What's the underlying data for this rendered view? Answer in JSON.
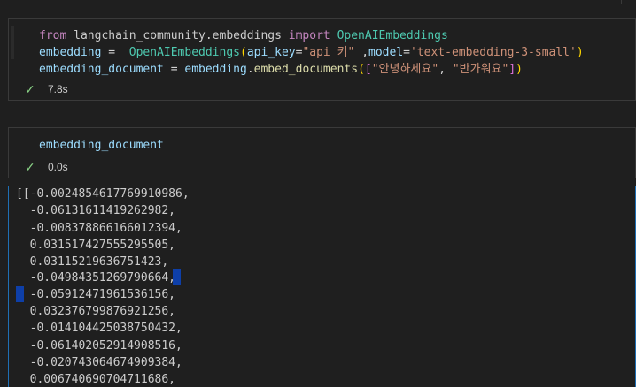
{
  "cells": [
    {
      "code": {
        "line1": {
          "kw_from": "from",
          "module": "langchain_community.embeddings",
          "kw_import": "import",
          "cls": "OpenAIEmbeddings"
        },
        "line2": {
          "var": "embedding",
          "eq": "=",
          "cls": "OpenAIEmbeddings",
          "paren_open": "(",
          "arg1_name": "api_key",
          "arg1_eq": "=",
          "arg1_val": "\"api 키\"",
          "comma": " ,",
          "arg2_name": "model",
          "arg2_eq": "=",
          "arg2_val": "'text-embedding-3-small'",
          "paren_close": ")"
        },
        "line3": {
          "var": "embedding_document",
          "eq": "=",
          "obj": "embedding",
          "dot": ".",
          "fn": "embed_documents",
          "paren_open": "(",
          "bracket_open": "[",
          "str1": "\"안녕하세요\"",
          "comma": ",",
          "str2": "\"반가워요\"",
          "bracket_close": "]",
          "paren_close": ")"
        }
      },
      "status": {
        "icon": "check-icon",
        "time": "7.8s"
      }
    },
    {
      "code": {
        "line1": {
          "var": "embedding_document"
        }
      },
      "status": {
        "icon": "check-icon",
        "time": "0.0s"
      }
    }
  ],
  "output": {
    "lines": [
      "[[-0.0024854617769910986,",
      "  -0.06131611419262982,",
      "  -0.008378866166012394,",
      "  0.031517427555295505,",
      "  0.03115219636751423,",
      "  -0.04984351269790664,",
      "  -0.05912471961536156,",
      "  0.032376799876921256,",
      "  -0.014104425038750432,",
      "  -0.061402052914908516,",
      "  -0.020743064674909384,",
      "  0.006740690704711686,"
    ]
  },
  "colors": {
    "background": "#1f1f1f",
    "cell_border": "#3a3a3a",
    "output_border": "#1f6fb4",
    "check": "#89d185"
  }
}
